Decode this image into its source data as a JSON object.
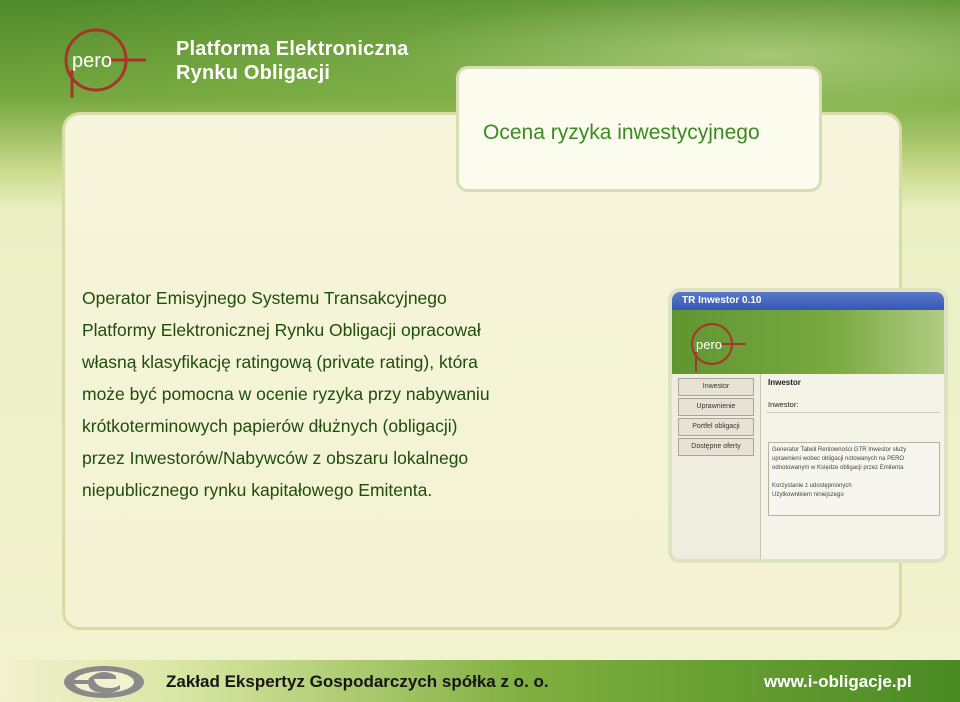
{
  "header": {
    "logo_text": "pero",
    "brand_line1": "Platforma Elektroniczna",
    "brand_line2": "Rynku Obligacji"
  },
  "slide": {
    "title": "Ocena ryzyka inwestycyjnego",
    "body_lines": [
      "Operator Emisyjnego Systemu Transakcyjnego",
      "Platformy Elektronicznej Rynku Obligacji opracował",
      "własną klasyfikację ratingową (private rating), która",
      "może być pomocna w ocenie ryzyka przy nabywaniu",
      "krótkoterminowych papierów dłużnych (obligacji)",
      "przez Inwestorów/Nabywców z obszaru lokalnego",
      "niepublicznego rynku kapitałowego Emitenta."
    ]
  },
  "screenshot": {
    "window_title": "TR Inwestor 0.10",
    "logo_text": "pero",
    "menu": [
      "Inwestor",
      "Uprawnienie",
      "Portfel obligacji",
      "Dostępne oferty"
    ],
    "heading": "Inwestor",
    "field_label": "Inwestor:",
    "info_lines": [
      "Generator Tabeli Rentowności GTR Inwestor służy",
      "uprawnieni wobec obligacji notowanych na PERO",
      "odnotowanym w Księdze obligacji przez Emitenta",
      "",
      "Korzystanie z udostępnionych",
      "Użytkownikiem niniejszego"
    ]
  },
  "footer": {
    "company": "Zakład Ekspertyz Gospodarczych spółka z o. o.",
    "url": "www.i-obligacje.pl"
  },
  "colors": {
    "brand_green": "#4f8a2a",
    "title_green": "#3c8a21",
    "text_dark_green": "#1f4d0e",
    "logo_red": "#a8352a"
  }
}
